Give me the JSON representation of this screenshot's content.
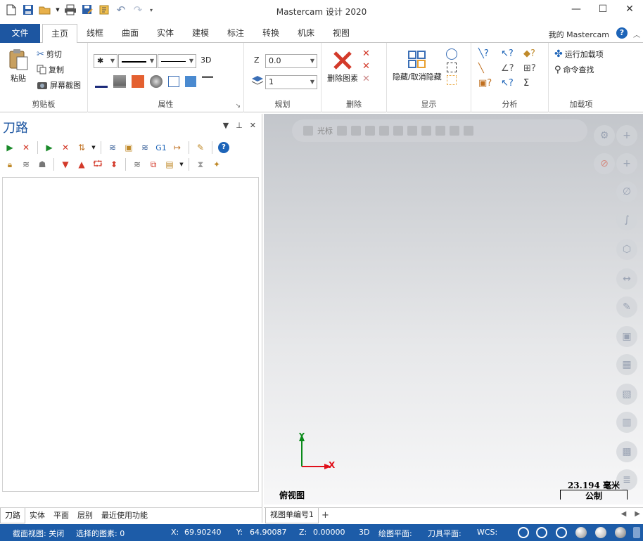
{
  "window": {
    "title": "Mastercam 设计 2020",
    "controls": [
      "—",
      "☐",
      "✕"
    ]
  },
  "ribbon_tabs": [
    "文件",
    "主页",
    "线框",
    "曲面",
    "实体",
    "建模",
    "标注",
    "转换",
    "机床",
    "视图"
  ],
  "my_mastercam": "我的 Mastercam",
  "clipboard": {
    "paste": "粘贴",
    "cut": "剪切",
    "copy": "复制",
    "screenshot": "屏幕截图",
    "label": "剪贴板"
  },
  "attributes": {
    "mode_3d": "3D",
    "label": "属性"
  },
  "planning": {
    "z_label": "Z",
    "z_value": "0.0",
    "level_value": "1",
    "label": "规划"
  },
  "delete": {
    "delete_entities": "删除图素",
    "label": "删除"
  },
  "display": {
    "hide_unhide": "隐藏/取消隐藏",
    "label": "显示"
  },
  "analysis": {
    "label": "分析"
  },
  "addins": {
    "run_addin": "运行加载项",
    "command_finder": "命令查找",
    "label": "加载项"
  },
  "panel": {
    "title": "刀路",
    "tabs": [
      "刀路",
      "实体",
      "平面",
      "层别",
      "最近使用功能"
    ],
    "g1_label": "G1"
  },
  "viewport": {
    "toolbar_cursor": "光标",
    "view_name": "俯视图",
    "scale_value": "23.194 毫米",
    "scale_unit": "公制",
    "axis_x": "X",
    "axis_y": "Y"
  },
  "viewsheet": {
    "tab": "视图单编号1",
    "add": "+"
  },
  "status": {
    "section_view": "截面视图: 关闭",
    "selected": "选择的图素: 0",
    "x_label": "X:",
    "x_value": "69.90240",
    "y_label": "Y:",
    "y_value": "64.90087",
    "z_label": "Z:",
    "z_value": "0.00000",
    "mode": "3D",
    "cplane": "绘图平面:",
    "tplane": "刀具平面:",
    "wcs": "WCS:"
  },
  "colors": {
    "brand_blue": "#1d56a1",
    "status_blue": "#1d5ca8",
    "axis_x": "#e0101a",
    "axis_y": "#0a8a1a",
    "delete_red": "#d33a2a"
  }
}
